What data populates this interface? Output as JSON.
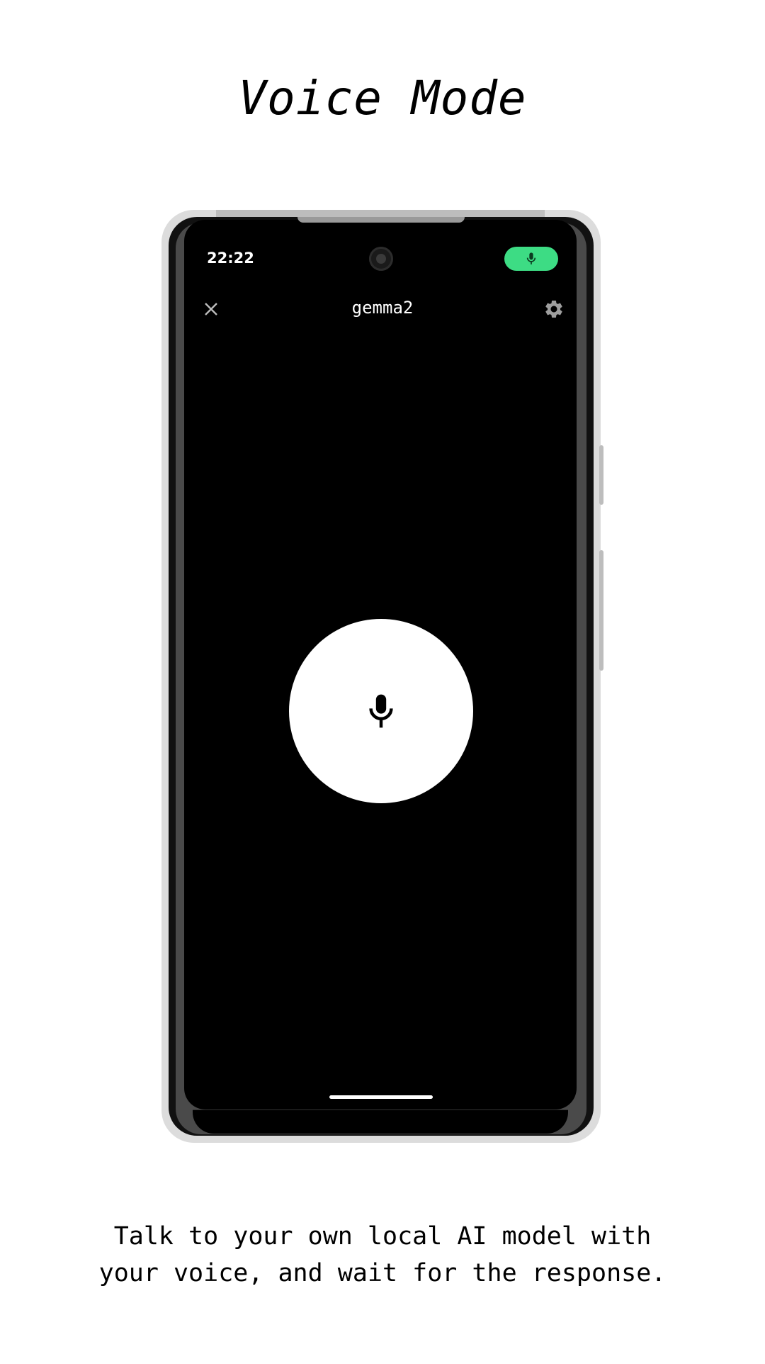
{
  "headline": "Voice Mode",
  "status_bar": {
    "time": "22:22",
    "mic_indicator_icon": "mic-icon",
    "mic_indicator_color": "#3ddc84"
  },
  "app_bar": {
    "close_icon": "close-icon",
    "title": "gemma2",
    "settings_icon": "gear-icon"
  },
  "main": {
    "record_button_icon": "mic-icon"
  },
  "caption": {
    "line1": "Talk to your own local AI model with",
    "line2": "your voice, and wait for the response."
  }
}
